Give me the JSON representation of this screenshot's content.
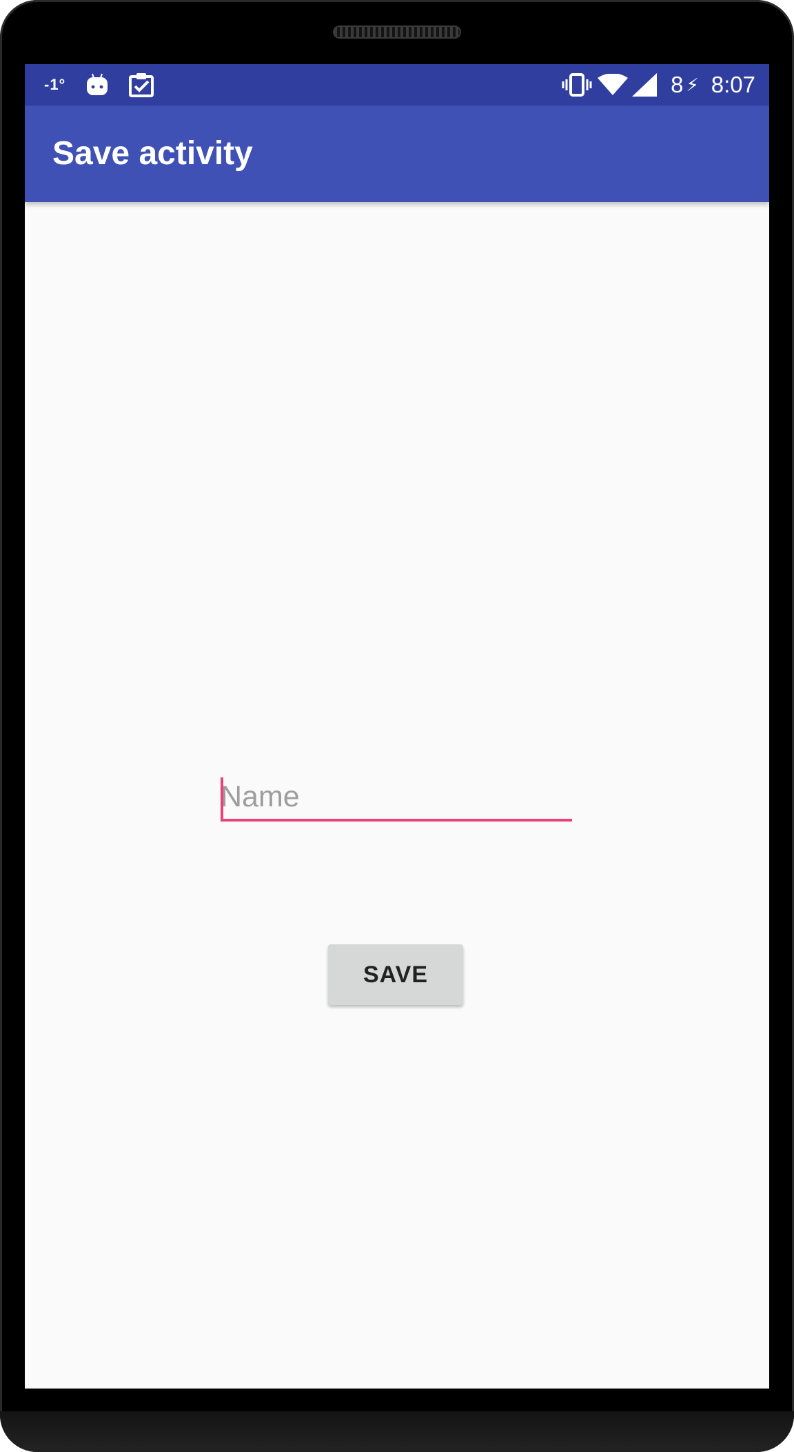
{
  "status_bar": {
    "temperature": "-1°",
    "battery_level": "8",
    "charging_symbol": "⚡",
    "time": "8:07",
    "icons": [
      "android-icon",
      "clipboard-check-icon",
      "vibrate-icon",
      "wifi-icon",
      "cell-signal-icon",
      "charging-icon"
    ]
  },
  "app_bar": {
    "title": "Save activity"
  },
  "form": {
    "name_placeholder": "Name",
    "name_value": "",
    "save_label": "SAVE"
  },
  "colors": {
    "status_bar": "#303f9f",
    "app_bar": "#3f51b5",
    "accent": "#ec407a",
    "background": "#fafafa",
    "button": "#d6d7d7"
  }
}
